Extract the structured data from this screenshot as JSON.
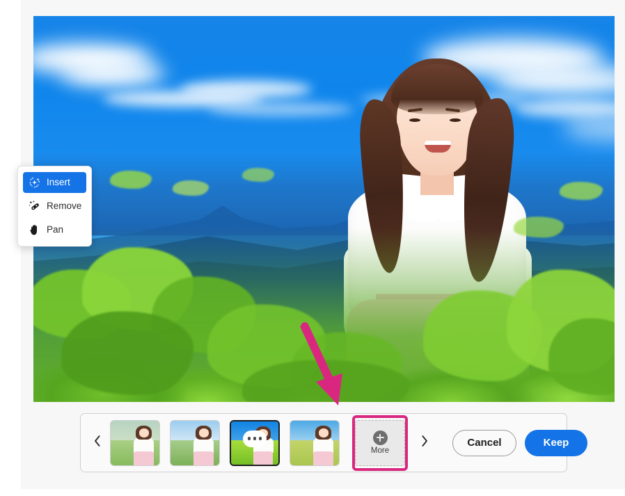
{
  "app": {
    "name": "image-editor-generative-fill"
  },
  "tool_menu": {
    "items": [
      {
        "label": "Insert",
        "icon": "sparkle-brush-icon",
        "active": true
      },
      {
        "label": "Remove",
        "icon": "magic-eraser-icon",
        "active": false
      },
      {
        "label": "Pan",
        "icon": "hand-icon",
        "active": false
      }
    ]
  },
  "canvas": {
    "alt": "Portrait of a smiling woman in a white blouse and pink skirt in front of a blue sky with mountains and green foliage"
  },
  "annotation": {
    "type": "arrow",
    "color": "#d9277f",
    "points_to": "more-variations-button"
  },
  "filmstrip": {
    "prev_label": "‹",
    "next_label": "›",
    "prev_icon": "chevron-left-icon",
    "next_icon": "chevron-right-icon",
    "thumbnails": [
      {
        "index": 1,
        "selected": false,
        "has_options_badge": false,
        "sky": "#9ec6de",
        "ground": "#8fbf6a",
        "name": "variation-1"
      },
      {
        "index": 2,
        "selected": false,
        "has_options_badge": false,
        "sky": "#a9d4ef",
        "ground": "#93c27d",
        "name": "variation-2"
      },
      {
        "index": 3,
        "selected": true,
        "has_options_badge": true,
        "sky": "#1e8ae0",
        "ground": "#9ed236",
        "name": "variation-3"
      },
      {
        "index": 4,
        "selected": false,
        "has_options_badge": false,
        "sky": "#6fb6e8",
        "ground": "#b9cf62",
        "name": "variation-4"
      }
    ],
    "more": {
      "label": "More",
      "icon": "plus-circle-icon",
      "highlighted": true,
      "highlight_color": "#d9277f"
    },
    "buttons": {
      "cancel": "Cancel",
      "keep": "Keep"
    }
  },
  "colors": {
    "accent_blue": "#1473e6",
    "highlight_magenta": "#d9277f",
    "panel_bg": "#fafafa",
    "page_bg": "#f7f7f7"
  }
}
